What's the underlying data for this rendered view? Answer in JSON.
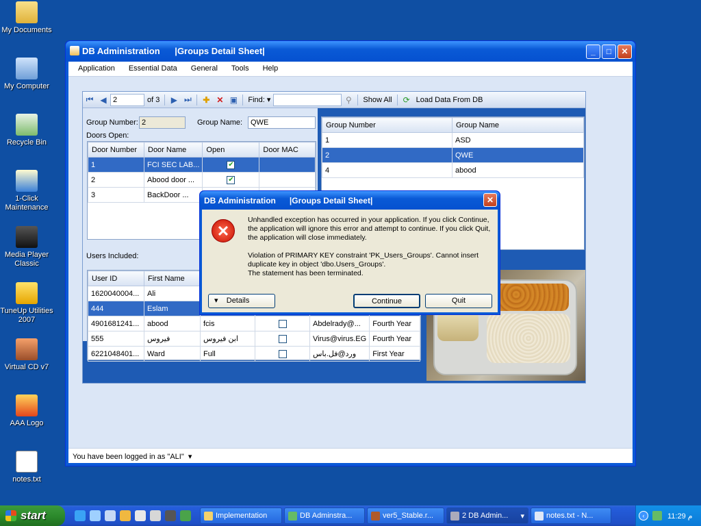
{
  "desktop": {
    "icons": [
      {
        "label": "My Documents"
      },
      {
        "label": "My Computer"
      },
      {
        "label": "Recycle Bin"
      },
      {
        "label": "1-Click Maintenance"
      },
      {
        "label": "Media Player Classic"
      },
      {
        "label": "TuneUp Utilities 2007"
      },
      {
        "label": "Virtual CD v7"
      },
      {
        "label": "AAA Logo"
      },
      {
        "label": "notes.txt"
      }
    ]
  },
  "window": {
    "title": "DB Administration      |Groups Detail Sheet|",
    "menu": [
      "Application",
      "Essential Data",
      "General",
      "Tools",
      "Help"
    ],
    "toolbar": {
      "position": "2",
      "of_label": "of 3",
      "find_label": "Find:",
      "find_value": "",
      "show_all": "Show All",
      "load_data": "Load Data From DB"
    },
    "form": {
      "group_number_label": "Group Number:",
      "group_number_value": "2",
      "group_name_label": "Group Name:",
      "group_name_value": "QWE",
      "doors_open_label": "Doors Open:",
      "users_included_label": "Users Included:"
    },
    "doors_grid": {
      "headers": [
        "Door Number",
        "Door Name",
        "Open",
        "Door MAC"
      ],
      "rows": [
        {
          "number": "1",
          "name": "FCI SEC LAB...",
          "open": true,
          "mac": ""
        },
        {
          "number": "2",
          "name": "Abood door  ...",
          "open": true,
          "mac": ""
        },
        {
          "number": "3",
          "name": "BackDoor    ...",
          "open": false,
          "mac": ""
        }
      ]
    },
    "groups_grid": {
      "headers": [
        "Group Number",
        "Group Name"
      ],
      "rows": [
        {
          "number": "1",
          "name": "ASD"
        },
        {
          "number": "2",
          "name": "QWE"
        },
        {
          "number": "4",
          "name": "abood"
        }
      ]
    },
    "users_grid": {
      "headers": [
        "User ID",
        "First Name"
      ],
      "rows": [
        {
          "id": "1620040004...",
          "first": "Ali",
          "last": "",
          "email": "",
          "year": ""
        },
        {
          "id": "444",
          "first": "Eslam",
          "last": "",
          "email": "",
          "year": ""
        },
        {
          "id": "4901681241...",
          "first": "abood",
          "last": "fcis",
          "email": "Abdelrady@...",
          "year": "Fourth Year"
        },
        {
          "id": "555",
          "first": "فيروس",
          "last": "ابن فيروس",
          "email": "Virus@virus.EG",
          "year": "Fourth Year"
        },
        {
          "id": "6221048401...",
          "first": "Ward",
          "last": "Full",
          "email": "ورد@فل.باس",
          "year": "First Year"
        }
      ]
    },
    "status": "You have been logged in as \"ALI\""
  },
  "dialog": {
    "title": "DB Administration      |Groups Detail Sheet|",
    "message_1": "Unhandled exception has occurred in your application. If you click Continue, the application will ignore this error and attempt to continue. If you click Quit, the application will close immediately.",
    "message_2": "Violation of PRIMARY KEY constraint 'PK_Users_Groups'. Cannot insert duplicate key in object 'dbo.Users_Groups'.",
    "message_3": "The statement has been terminated.",
    "details": "Details",
    "continue": "Continue",
    "quit": "Quit"
  },
  "taskbar": {
    "start": "start",
    "tasks": [
      {
        "label": "Implementation"
      },
      {
        "label": "DB Adminstra..."
      },
      {
        "label": "ver5_Stable.r..."
      },
      {
        "label": "2 DB Admin..."
      },
      {
        "label": "notes.txt - N..."
      }
    ],
    "clock": "11:29 م"
  },
  "colors": {
    "desktop": "#0f4fa3",
    "selection": "#316ac5",
    "panel": "#1e5bb4"
  }
}
